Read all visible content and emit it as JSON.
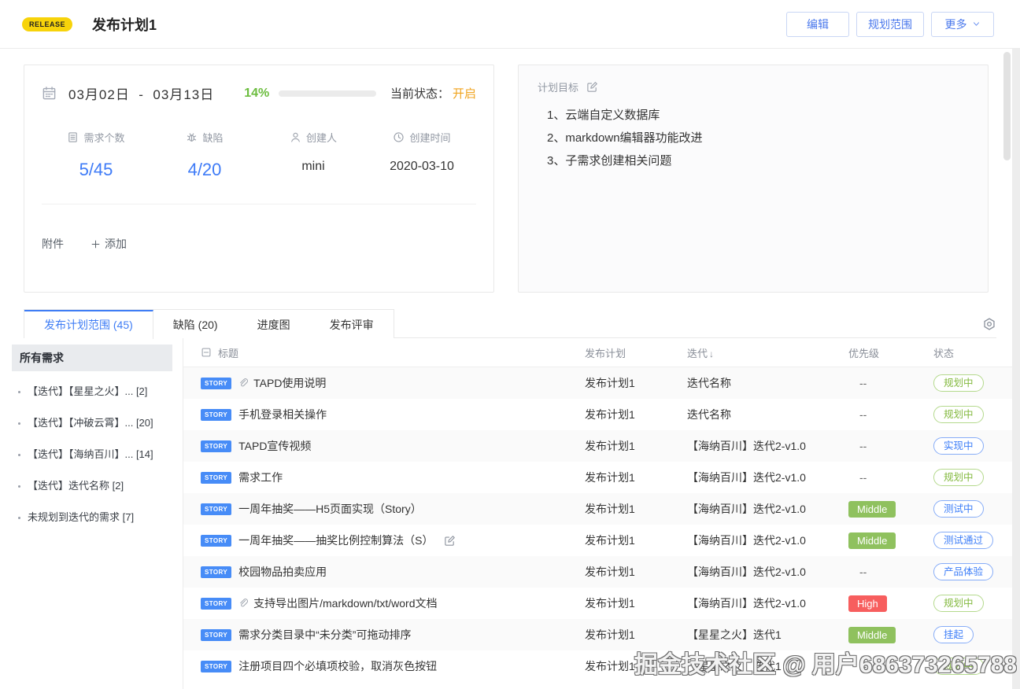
{
  "header": {
    "badge": "RELEASE",
    "title": "发布计划1",
    "buttons": {
      "edit": "编辑",
      "scope": "规划范围",
      "more": "更多"
    }
  },
  "overview": {
    "date_start": "03月02日",
    "date_separator": "-",
    "date_end": "03月13日",
    "progress_percent_label": "14%",
    "progress_value": 14,
    "status_label": "当前状态：",
    "status_value": "开启",
    "stats": [
      {
        "icon": "doc-icon",
        "label": "需求个数",
        "value": "5/45",
        "emphasis": "blue"
      },
      {
        "icon": "bug-icon",
        "label": "缺陷",
        "value": "4/20",
        "emphasis": "blue"
      },
      {
        "icon": "person-icon",
        "label": "创建人",
        "value": "mini",
        "emphasis": "dark"
      },
      {
        "icon": "clock-icon",
        "label": "创建时间",
        "value": "2020-03-10",
        "emphasis": "dark"
      }
    ],
    "attachment_label": "附件",
    "add_label": "添加"
  },
  "goals": {
    "title": "计划目标",
    "items": [
      "1、云端自定义数据库",
      "2、markdown编辑器功能改进",
      "3、子需求创建相关问题"
    ]
  },
  "tabs": {
    "items": [
      {
        "label": "发布计划范围 (45)",
        "active": true
      },
      {
        "label": "缺陷 (20)",
        "active": false
      },
      {
        "label": "进度图",
        "active": false
      },
      {
        "label": "发布评审",
        "active": false
      }
    ]
  },
  "sidebar": {
    "header": "所有需求",
    "items": [
      "【迭代】【星星之火】... [2]",
      "【迭代】【冲破云霄】... [20]",
      "【迭代】【海纳百川】... [14]",
      "【迭代】迭代名称 [2]",
      "未规划到迭代的需求 [7]"
    ]
  },
  "table": {
    "columns": {
      "title": "标题",
      "plan": "发布计划",
      "iteration": "迭代",
      "sort_indicator": "↓",
      "priority": "优先级",
      "status": "状态"
    },
    "badge_label": "STORY",
    "empty_priority": "--",
    "rows": [
      {
        "title": "TAPD使用说明",
        "attachment": true,
        "edit": false,
        "plan": "发布计划1",
        "iteration": "迭代名称",
        "priority": "",
        "priority_color": "",
        "status": "规划中",
        "status_color": "green"
      },
      {
        "title": "手机登录相关操作",
        "attachment": false,
        "edit": false,
        "plan": "发布计划1",
        "iteration": "迭代名称",
        "priority": "",
        "priority_color": "",
        "status": "规划中",
        "status_color": "green"
      },
      {
        "title": "TAPD宣传视频",
        "attachment": false,
        "edit": false,
        "plan": "发布计划1",
        "iteration": "【海纳百川】迭代2-v1.0",
        "priority": "",
        "priority_color": "",
        "status": "实现中",
        "status_color": "blue"
      },
      {
        "title": "需求工作",
        "attachment": false,
        "edit": false,
        "plan": "发布计划1",
        "iteration": "【海纳百川】迭代2-v1.0",
        "priority": "",
        "priority_color": "",
        "status": "规划中",
        "status_color": "green"
      },
      {
        "title": "一周年抽奖——H5页面实现（Story）",
        "attachment": false,
        "edit": false,
        "plan": "发布计划1",
        "iteration": "【海纳百川】迭代2-v1.0",
        "priority": "Middle",
        "priority_color": "green",
        "status": "测试中",
        "status_color": "blue"
      },
      {
        "title": "一周年抽奖——抽奖比例控制算法（S）",
        "attachment": false,
        "edit": true,
        "plan": "发布计划1",
        "iteration": "【海纳百川】迭代2-v1.0",
        "priority": "Middle",
        "priority_color": "green",
        "status": "测试通过",
        "status_color": "blue"
      },
      {
        "title": "校园物品拍卖应用",
        "attachment": false,
        "edit": false,
        "plan": "发布计划1",
        "iteration": "【海纳百川】迭代2-v1.0",
        "priority": "",
        "priority_color": "",
        "status": "产品体验",
        "status_color": "blue"
      },
      {
        "title": "支持导出图片/markdown/txt/word文档",
        "attachment": true,
        "edit": false,
        "plan": "发布计划1",
        "iteration": "【海纳百川】迭代2-v1.0",
        "priority": "High",
        "priority_color": "red",
        "status": "规划中",
        "status_color": "green"
      },
      {
        "title": "需求分类目录中“未分类”可拖动排序",
        "attachment": false,
        "edit": false,
        "plan": "发布计划1",
        "iteration": "【星星之火】迭代1",
        "priority": "Middle",
        "priority_color": "green",
        "status": "挂起",
        "status_color": "blue"
      },
      {
        "title": "注册项目四个必填项校验，取消灰色按钮",
        "attachment": false,
        "edit": false,
        "plan": "发布计划1",
        "iteration": "【星星之火】迭代1",
        "priority": "",
        "priority_color": "",
        "status": "规划中",
        "status_color": "green"
      }
    ]
  },
  "watermark": "掘金技术社区 @ 用户686373265788",
  "colors": {
    "accent_blue": "#3f7df5",
    "progress_green": "#5fc35f",
    "status_open_orange": "#f0a31c",
    "story_badge_blue": "#478cf7",
    "priority_middle_green": "#8fc15e",
    "priority_high_red": "#f75e5e",
    "pill_green_text": "#83b93e",
    "pill_blue_text": "#3d7ef8",
    "release_badge_yellow": "#f7d30a"
  }
}
